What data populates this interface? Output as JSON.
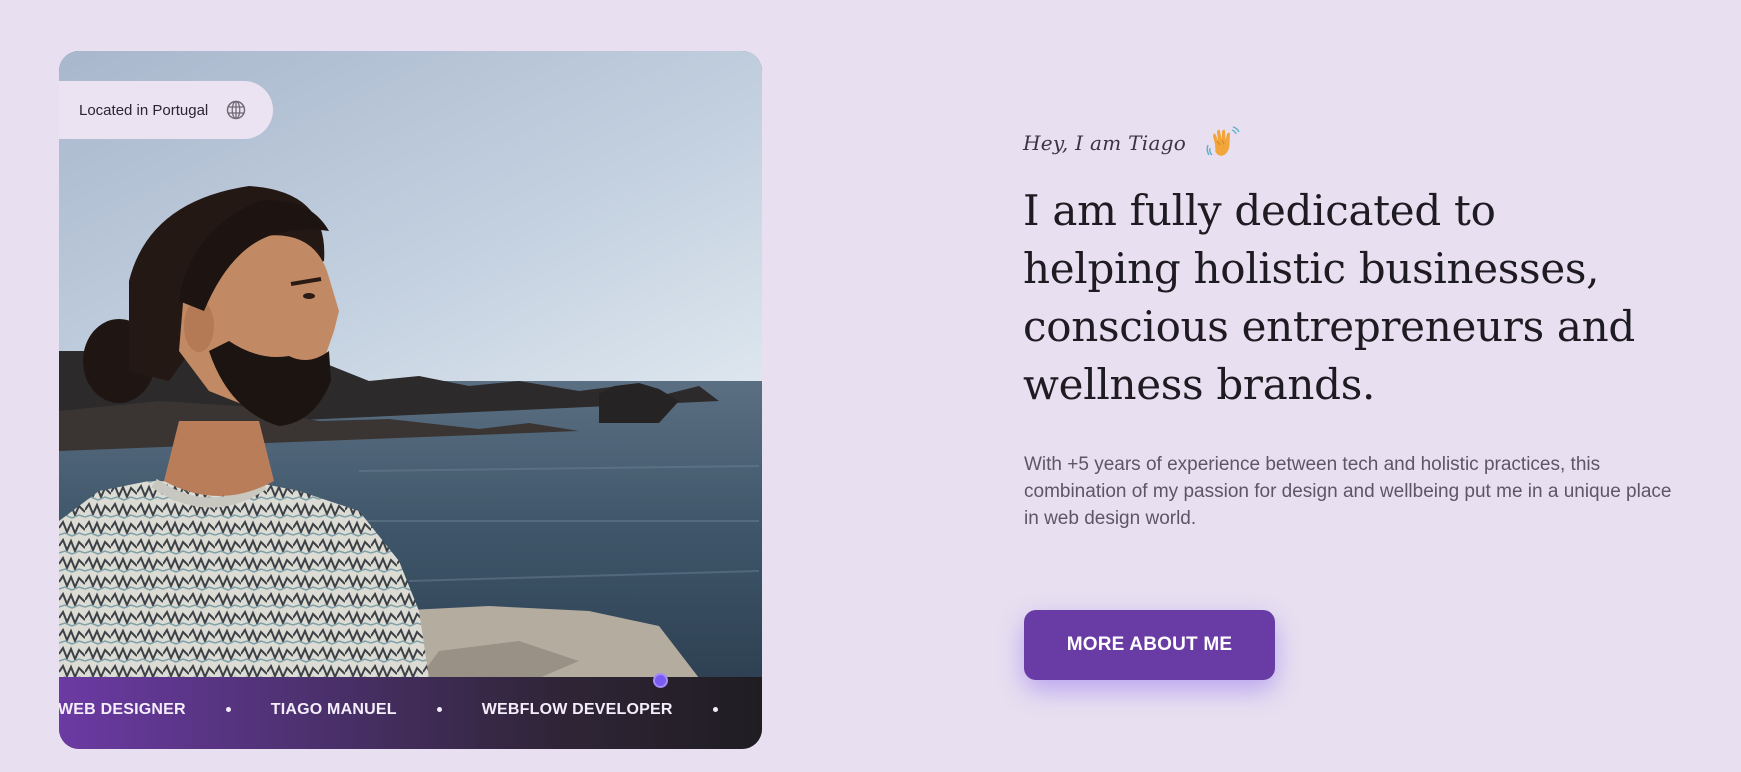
{
  "location": {
    "label": "Located in Portugal",
    "icon": "globe-icon"
  },
  "marquee": {
    "items": [
      "WEB DESIGNER",
      "TIAGO MANUEL",
      "WEBFLOW DEVELOPER"
    ]
  },
  "hero": {
    "greeting": "Hey, I am Tiago",
    "greeting_icon": "waving-hand-icon",
    "headline": "I am fully dedicated to helping holistic businesses, conscious entrepreneurs and wellness brands.",
    "bio": "With +5 years of experience between tech and holistic practices, this combination of my passion for design and wellbeing put me in a unique place in web design world.",
    "cta_label": "MORE ABOUT ME"
  },
  "colors": {
    "background": "#e8e0f0",
    "accent": "#693ca5",
    "indicator": "#7a5cf0",
    "heading": "#1e1b22",
    "body_text": "#5d5668"
  }
}
